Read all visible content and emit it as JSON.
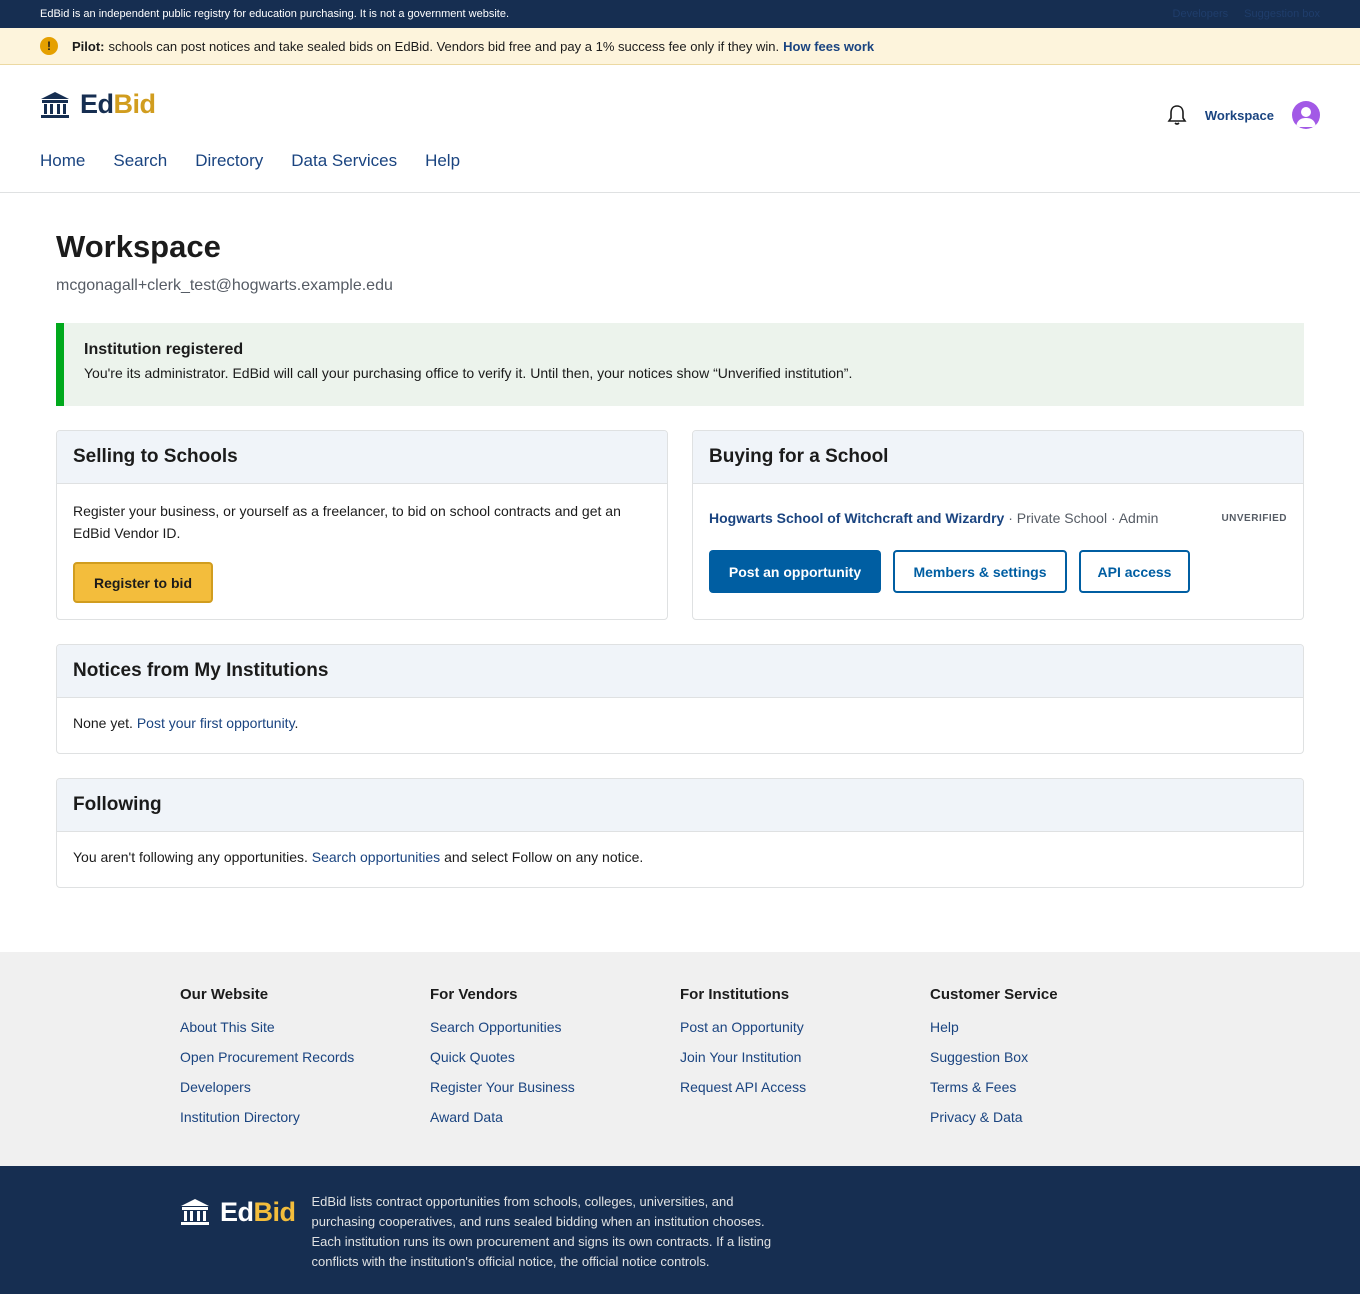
{
  "topbar": {
    "notice": "EdBid is an independent public registry for education purchasing. It is not a government website.",
    "links": [
      "Developers",
      "Suggestion box"
    ]
  },
  "pilot": {
    "label": "Pilot:",
    "text": "schools can post notices and take sealed bids on EdBid. Vendors bid free and pay a 1% success fee only if they win.",
    "link": "How fees work"
  },
  "brand": {
    "ed": "Ed",
    "bid": "Bid"
  },
  "header": {
    "workspace_link": "Workspace",
    "nav": [
      "Home",
      "Search",
      "Directory",
      "Data Services",
      "Help"
    ]
  },
  "page": {
    "title": "Workspace",
    "email": "mcgonagall+clerk_test@hogwarts.example.edu"
  },
  "alert": {
    "title": "Institution registered",
    "body": "You're its administrator. EdBid will call your purchasing office to verify it. Until then, your notices show “Unverified institution”."
  },
  "selling": {
    "title": "Selling to Schools",
    "text": "Register your business, or yourself as a freelancer, to bid on school contracts and get an EdBid Vendor ID.",
    "button": "Register to bid"
  },
  "buying": {
    "title": "Buying for a School",
    "institution_name": "Hogwarts School of Witchcraft and Wizardry",
    "institution_meta": " · Private School · Admin",
    "status": "UNVERIFIED",
    "buttons": {
      "post": "Post an opportunity",
      "members": "Members & settings",
      "api": "API access"
    }
  },
  "notices": {
    "title": "Notices from My Institutions",
    "prefix": "None yet.",
    "link": "Post your first opportunity",
    "suffix": "."
  },
  "following": {
    "title": "Following",
    "prefix": "You aren't following any opportunities.",
    "link": "Search opportunities",
    "suffix": "and select Follow on any notice."
  },
  "footer": {
    "columns": [
      {
        "heading": "Our Website",
        "links": [
          "About This Site",
          "Open Procurement Records",
          "Developers",
          "Institution Directory"
        ]
      },
      {
        "heading": "For Vendors",
        "links": [
          "Search Opportunities",
          "Quick Quotes",
          "Register Your Business",
          "Award Data"
        ]
      },
      {
        "heading": "For Institutions",
        "links": [
          "Post an Opportunity",
          "Join Your Institution",
          "Request API Access"
        ]
      },
      {
        "heading": "Customer Service",
        "links": [
          "Help",
          "Suggestion Box",
          "Terms & Fees",
          "Privacy & Data"
        ]
      }
    ],
    "description": "EdBid lists contract opportunities from schools, colleges, universities, and purchasing cooperatives, and runs sealed bidding when an institution chooses. Each institution runs its own procurement and signs its own contracts. If a listing conflicts with the institution's official notice, the official notice controls."
  },
  "icons": {
    "logo": "institution-building-icon",
    "alert": "exclamation-icon",
    "notifications": "bell-icon",
    "avatar": "user-avatar-icon"
  },
  "colors": {
    "navy": "#162e51",
    "gold": "#d19d1f",
    "primary": "#005ea2",
    "success": "#00a91c",
    "link": "#1a4480"
  }
}
